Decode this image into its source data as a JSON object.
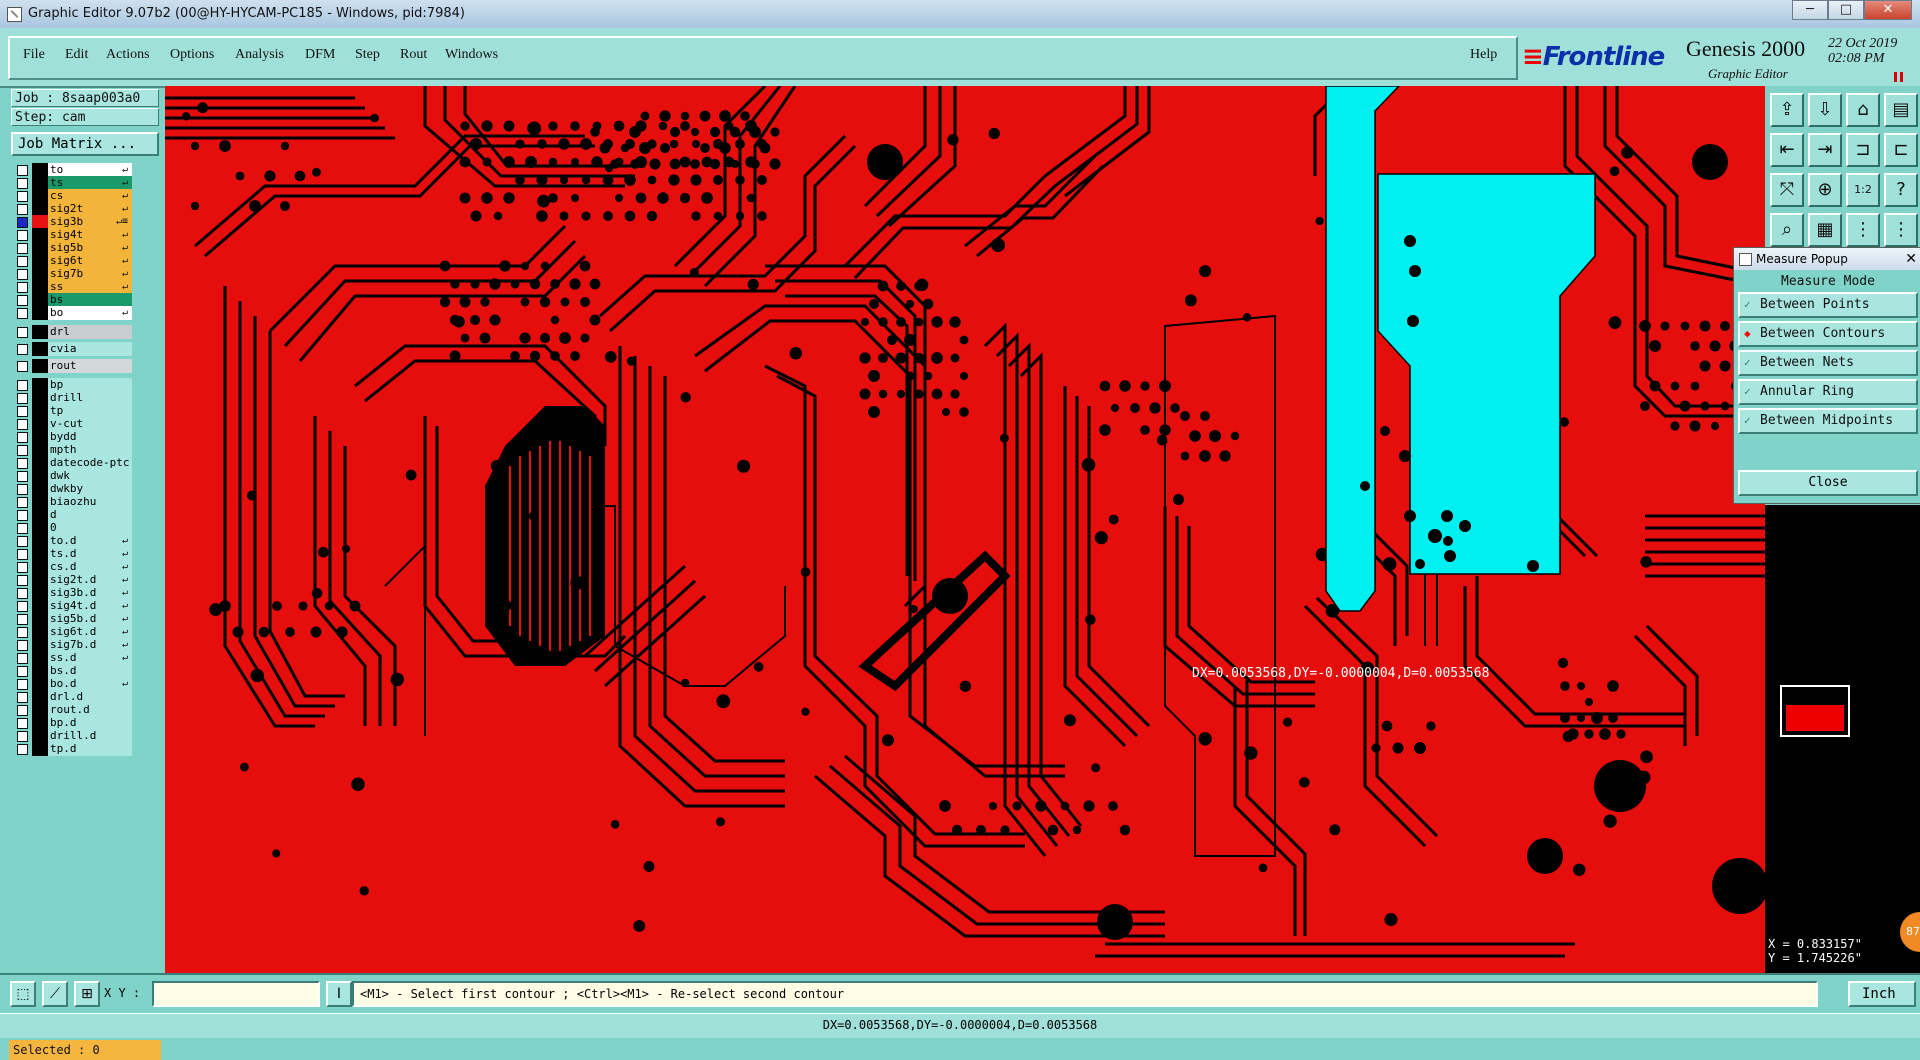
{
  "window": {
    "title": "Graphic Editor 9.07b2 (00@HY-HYCAM-PC185 - Windows, pid:7984)",
    "minimize": "─",
    "maximize": "□",
    "close": "✕"
  },
  "menu": {
    "items": [
      "File",
      "Edit",
      "Actions",
      "Options",
      "Analysis",
      "DFM",
      "Step",
      "Rout",
      "Windows"
    ],
    "help": "Help"
  },
  "brand": {
    "logo_pre": "",
    "logo": "Frontline",
    "product": "Genesis 2000",
    "subtitle": "Graphic Editor",
    "date": "22 Oct 2019",
    "time": "02:08 PM"
  },
  "job": {
    "job_label": "Job : 8saap003a0",
    "step_label": "Step: cam",
    "matrix_button": "Job Matrix ..."
  },
  "layers": [
    {
      "name": "to",
      "bg": "#ffffff",
      "arrow": "↵",
      "checked": false,
      "swatch": "black"
    },
    {
      "name": "ts",
      "bg": "#1a9a6c",
      "arrow": "↵",
      "checked": false,
      "swatch": "black"
    },
    {
      "name": "cs",
      "bg": "#f3b43a",
      "arrow": "↵",
      "checked": false,
      "swatch": "black"
    },
    {
      "name": "sig2t",
      "bg": "#f3b43a",
      "arrow": "↵",
      "checked": false,
      "swatch": "black"
    },
    {
      "name": "sig3b",
      "bg": "#f3b43a",
      "arrow": "↵≡",
      "checked": true,
      "swatch": "red"
    },
    {
      "name": "sig4t",
      "bg": "#f3b43a",
      "arrow": "↵",
      "checked": false,
      "swatch": "black"
    },
    {
      "name": "sig5b",
      "bg": "#f3b43a",
      "arrow": "↵",
      "checked": false,
      "swatch": "black"
    },
    {
      "name": "sig6t",
      "bg": "#f3b43a",
      "arrow": "↵",
      "checked": false,
      "swatch": "black"
    },
    {
      "name": "sig7b",
      "bg": "#f3b43a",
      "arrow": "↵",
      "checked": false,
      "swatch": "black"
    },
    {
      "name": "ss",
      "bg": "#f3b43a",
      "arrow": "↵",
      "checked": false,
      "swatch": "black"
    },
    {
      "name": "bs",
      "bg": "#1a9a6c",
      "arrow": "",
      "checked": false,
      "swatch": "black"
    },
    {
      "name": "bo",
      "bg": "#ffffff",
      "arrow": "↵",
      "checked": false,
      "swatch": "black"
    },
    {
      "name": "drl",
      "bg": "#c7cdd1",
      "arrow": "",
      "checked": false,
      "swatch": "black"
    },
    {
      "name": "cvia",
      "bg": "#a8e6df",
      "arrow": "",
      "checked": false,
      "swatch": "black"
    },
    {
      "name": "rout",
      "bg": "#d3d8da",
      "arrow": "",
      "checked": false,
      "swatch": "black"
    },
    {
      "name": "bp",
      "bg": "#a8e6df",
      "arrow": "",
      "checked": false,
      "swatch": "black"
    },
    {
      "name": "drill",
      "bg": "#a8e6df",
      "arrow": "",
      "checked": false,
      "swatch": "black"
    },
    {
      "name": "tp",
      "bg": "#a8e6df",
      "arrow": "",
      "checked": false,
      "swatch": "black"
    },
    {
      "name": "v-cut",
      "bg": "#a8e6df",
      "arrow": "",
      "checked": false,
      "swatch": "black"
    },
    {
      "name": "bydd",
      "bg": "#a8e6df",
      "arrow": "",
      "checked": false,
      "swatch": "black"
    },
    {
      "name": "mpth",
      "bg": "#a8e6df",
      "arrow": "",
      "checked": false,
      "swatch": "black"
    },
    {
      "name": "datecode-ptc",
      "bg": "#a8e6df",
      "arrow": "",
      "checked": false,
      "swatch": "black"
    },
    {
      "name": "dwk",
      "bg": "#a8e6df",
      "arrow": "",
      "checked": false,
      "swatch": "black"
    },
    {
      "name": "dwkby",
      "bg": "#a8e6df",
      "arrow": "",
      "checked": false,
      "swatch": "black"
    },
    {
      "name": "biaozhu",
      "bg": "#a8e6df",
      "arrow": "",
      "checked": false,
      "swatch": "black"
    },
    {
      "name": "d",
      "bg": "#a8e6df",
      "arrow": "",
      "checked": false,
      "swatch": "black"
    },
    {
      "name": "0",
      "bg": "#a8e6df",
      "arrow": "",
      "checked": false,
      "swatch": "black"
    },
    {
      "name": "to.d",
      "bg": "#a8e6df",
      "arrow": "↵",
      "checked": false,
      "swatch": "black"
    },
    {
      "name": "ts.d",
      "bg": "#a8e6df",
      "arrow": "↵",
      "checked": false,
      "swatch": "black"
    },
    {
      "name": "cs.d",
      "bg": "#a8e6df",
      "arrow": "↵",
      "checked": false,
      "swatch": "black"
    },
    {
      "name": "sig2t.d",
      "bg": "#a8e6df",
      "arrow": "↵",
      "checked": false,
      "swatch": "black"
    },
    {
      "name": "sig3b.d",
      "bg": "#a8e6df",
      "arrow": "↵",
      "checked": false,
      "swatch": "black"
    },
    {
      "name": "sig4t.d",
      "bg": "#a8e6df",
      "arrow": "↵",
      "checked": false,
      "swatch": "black"
    },
    {
      "name": "sig5b.d",
      "bg": "#a8e6df",
      "arrow": "↵",
      "checked": false,
      "swatch": "black"
    },
    {
      "name": "sig6t.d",
      "bg": "#a8e6df",
      "arrow": "↵",
      "checked": false,
      "swatch": "black"
    },
    {
      "name": "sig7b.d",
      "bg": "#a8e6df",
      "arrow": "↵",
      "checked": false,
      "swatch": "black"
    },
    {
      "name": "ss.d",
      "bg": "#a8e6df",
      "arrow": "↵",
      "checked": false,
      "swatch": "black"
    },
    {
      "name": "bs.d",
      "bg": "#a8e6df",
      "arrow": "",
      "checked": false,
      "swatch": "black"
    },
    {
      "name": "bo.d",
      "bg": "#a8e6df",
      "arrow": "↵",
      "checked": false,
      "swatch": "black"
    },
    {
      "name": "drl.d",
      "bg": "#a8e6df",
      "arrow": "",
      "checked": false,
      "swatch": "black"
    },
    {
      "name": "rout.d",
      "bg": "#a8e6df",
      "arrow": "",
      "checked": false,
      "swatch": "black"
    },
    {
      "name": "bp.d",
      "bg": "#a8e6df",
      "arrow": "",
      "checked": false,
      "swatch": "black"
    },
    {
      "name": "drill.d",
      "bg": "#a8e6df",
      "arrow": "",
      "checked": false,
      "swatch": "black"
    },
    {
      "name": "tp.d",
      "bg": "#a8e6df",
      "arrow": "",
      "checked": false,
      "swatch": "black"
    }
  ],
  "selected_label": "Selected : 0",
  "measure_overlay": "DX=0.0053568,DY=-0.0000004,D=0.0053568",
  "popup": {
    "title": "Measure Popup",
    "close_x": "✕",
    "mode_label": "Measure Mode",
    "options": [
      {
        "label": "Between Points",
        "selected": false
      },
      {
        "label": "Between Contours",
        "selected": true
      },
      {
        "label": "Between Nets",
        "selected": false
      },
      {
        "label": "Annular Ring",
        "selected": false
      },
      {
        "label": "Between Midpoints",
        "selected": false
      }
    ],
    "close_button": "Close"
  },
  "coords": {
    "x": "X = 0.833157\"",
    "y": "Y = 1.745226\""
  },
  "badge": "87",
  "bottom": {
    "xy_label": "X Y :",
    "xy_value": "",
    "prompt": "<M1> - Select first contour ; <Ctrl><M1> - Re-select second contour",
    "units": "Inch"
  },
  "status": "DX=0.0053568,DY=-0.0000004,D=0.0053568",
  "toolbar_icons": [
    "open-icon",
    "save-icon",
    "home-icon",
    "layers-icon",
    "pan-left-icon",
    "pan-right-icon",
    "snap-icon",
    "stretch-icon",
    "zoom-fit-icon",
    "zoom-in-icon",
    "zoom-1to2-icon",
    "help-icon",
    "measure-icon",
    "grid-icon",
    "net-icon",
    "net2-icon"
  ],
  "colors": {
    "board": "#e60d0d",
    "copper": "#000000",
    "highlight": "#00f0f0",
    "panel": "#7fd3c8"
  }
}
